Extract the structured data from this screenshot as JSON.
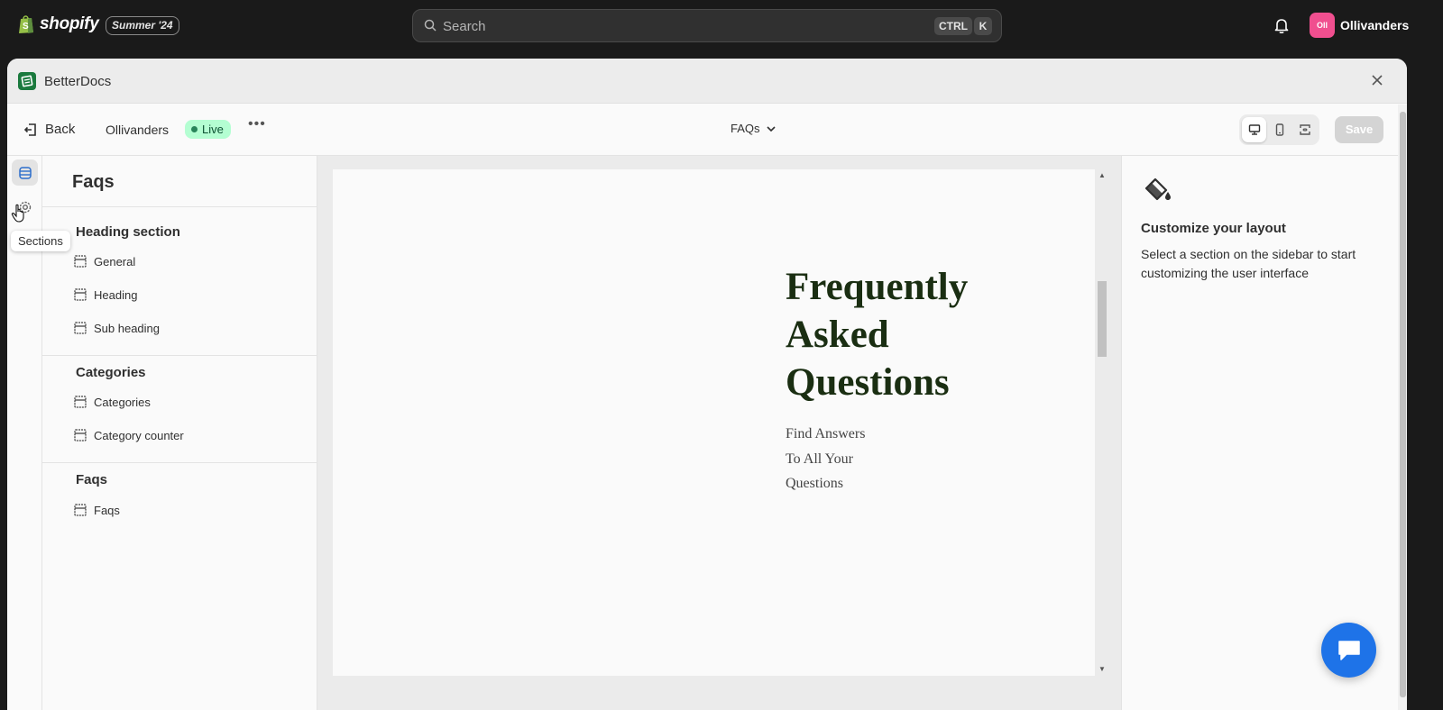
{
  "topbar": {
    "brand": "shopify",
    "season_badge": "Summer '24",
    "search_placeholder": "Search",
    "shortcut_ctrl": "CTRL",
    "shortcut_k": "K",
    "store_initials": "Oll",
    "store_name": "Ollivanders"
  },
  "app": {
    "title": "BetterDocs"
  },
  "editor": {
    "back_label": "Back",
    "store_label": "Ollivanders",
    "status": "Live",
    "page_selector": "FAQs",
    "save_label": "Save",
    "device_icons": [
      "desktop-icon",
      "mobile-icon",
      "fullscreen-icon"
    ]
  },
  "rail": {
    "tooltip": "Sections"
  },
  "sections": {
    "title": "Faqs",
    "groups": [
      {
        "title": "Heading section",
        "items": [
          "General",
          "Heading",
          "Sub heading"
        ]
      },
      {
        "title": "Categories",
        "items": [
          "Categories",
          "Category counter"
        ]
      },
      {
        "title": "Faqs",
        "items": [
          "Faqs"
        ]
      }
    ]
  },
  "preview": {
    "heading": "Frequently Asked Questions",
    "subheading": "Find Answers To All Your Questions"
  },
  "right_panel": {
    "title": "Customize your layout",
    "description": "Select a section on the sidebar to start customizing the user interface"
  },
  "colors": {
    "accent_live": "#b4fed2",
    "store_avatar": "#f04f8f",
    "chat_button": "#1e73e8",
    "heading_text": "#1a2e12"
  }
}
